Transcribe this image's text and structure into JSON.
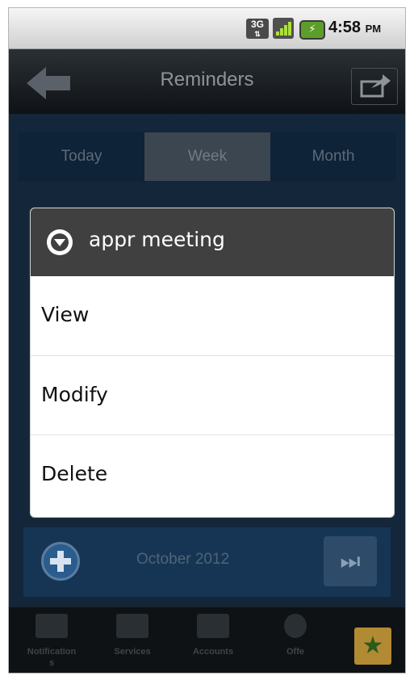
{
  "status_bar": {
    "network_badge": "3G",
    "time": "4:58",
    "ampm": "PM",
    "icons": [
      "network-3g-icon",
      "signal-icon",
      "battery-icon"
    ]
  },
  "title_bar": {
    "title": "Reminders",
    "back_icon": "back-arrow-icon",
    "share_icon": "share-icon"
  },
  "tabs": [
    {
      "label": "Today",
      "active": false
    },
    {
      "label": "Week",
      "active": true
    },
    {
      "label": "Month",
      "active": false
    }
  ],
  "month_bar": {
    "label": "October 2012",
    "add_icon": "add-circle-icon",
    "next_icon": "fast-forward-icon"
  },
  "bottom_nav": {
    "items": [
      {
        "label": "Notification\ns",
        "icon": "notifications-icon"
      },
      {
        "label": "Services",
        "icon": "services-icon"
      },
      {
        "label": "Accounts",
        "icon": "accounts-icon"
      },
      {
        "label": "Offe",
        "icon": "offers-icon"
      }
    ],
    "star_icon": "star-icon"
  },
  "dialog": {
    "title": "appr meeting",
    "icon": "dropdown-circle-icon",
    "items": [
      "View",
      "Modify",
      "Delete"
    ]
  },
  "colors": {
    "dialog_header": "#404040",
    "content_bg": "#13263a",
    "titlebar_text": "#8d949a"
  }
}
